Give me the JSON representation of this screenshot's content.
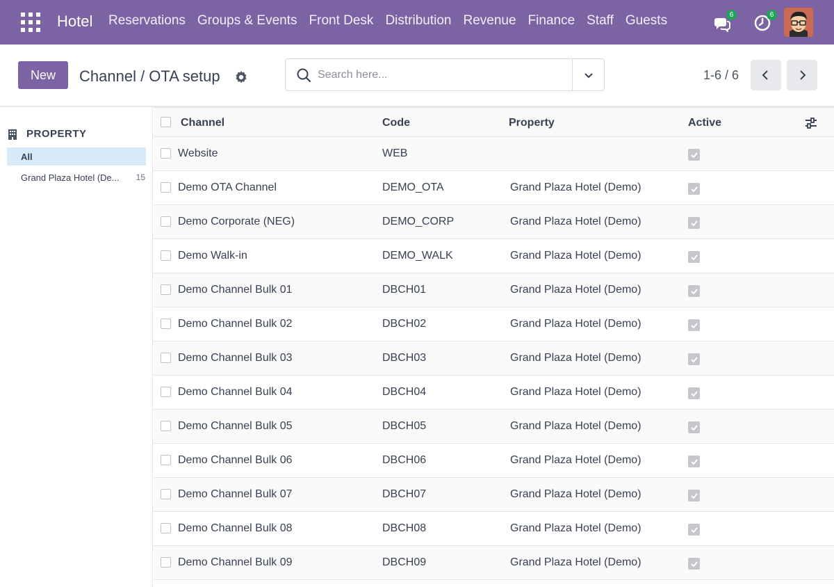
{
  "navbar": {
    "app_name": "Hotel",
    "menu": [
      "Reservations",
      "Groups & Events",
      "Front Desk",
      "Distribution",
      "Revenue",
      "Finance",
      "Staff",
      "Guests"
    ],
    "messages_badge": "6",
    "activities_badge": "6"
  },
  "control_panel": {
    "new_label": "New",
    "title": "Channel / OTA setup",
    "search_placeholder": "Search here...",
    "pager": "1-6 / 6"
  },
  "side_panel": {
    "header": "PROPERTY",
    "items": [
      {
        "label": "All",
        "count": ""
      },
      {
        "label": "Grand Plaza Hotel (De...",
        "count": "15"
      }
    ]
  },
  "table": {
    "columns": [
      "Channel",
      "Code",
      "Property",
      "Active"
    ],
    "rows": [
      {
        "channel": "Website",
        "code": "WEB",
        "property": "",
        "active": true
      },
      {
        "channel": "Demo OTA Channel",
        "code": "DEMO_OTA",
        "property": "Grand Plaza Hotel (Demo)",
        "active": true
      },
      {
        "channel": "Demo Corporate (NEG)",
        "code": "DEMO_CORP",
        "property": "Grand Plaza Hotel (Demo)",
        "active": true
      },
      {
        "channel": "Demo Walk-in",
        "code": "DEMO_WALK",
        "property": "Grand Plaza Hotel (Demo)",
        "active": true
      },
      {
        "channel": "Demo Channel Bulk 01",
        "code": "DBCH01",
        "property": "Grand Plaza Hotel (Demo)",
        "active": true
      },
      {
        "channel": "Demo Channel Bulk 02",
        "code": "DBCH02",
        "property": "Grand Plaza Hotel (Demo)",
        "active": true
      },
      {
        "channel": "Demo Channel Bulk 03",
        "code": "DBCH03",
        "property": "Grand Plaza Hotel (Demo)",
        "active": true
      },
      {
        "channel": "Demo Channel Bulk 04",
        "code": "DBCH04",
        "property": "Grand Plaza Hotel (Demo)",
        "active": true
      },
      {
        "channel": "Demo Channel Bulk 05",
        "code": "DBCH05",
        "property": "Grand Plaza Hotel (Demo)",
        "active": true
      },
      {
        "channel": "Demo Channel Bulk 06",
        "code": "DBCH06",
        "property": "Grand Plaza Hotel (Demo)",
        "active": true
      },
      {
        "channel": "Demo Channel Bulk 07",
        "code": "DBCH07",
        "property": "Grand Plaza Hotel (Demo)",
        "active": true
      },
      {
        "channel": "Demo Channel Bulk 08",
        "code": "DBCH08",
        "property": "Grand Plaza Hotel (Demo)",
        "active": true
      },
      {
        "channel": "Demo Channel Bulk 09",
        "code": "DBCH09",
        "property": "Grand Plaza Hotel (Demo)",
        "active": true
      }
    ]
  },
  "colors": {
    "brand": "#7c63a4",
    "badge": "#22a35a",
    "selected_filter": "#d6eaf8"
  },
  "icons": [
    "apps-grid-icon",
    "chat-icon",
    "clock-icon",
    "gear-icon",
    "search-icon",
    "chevron-down-icon",
    "chevron-left-icon",
    "chevron-right-icon",
    "building-icon",
    "sliders-icon",
    "checkbox-icon"
  ]
}
